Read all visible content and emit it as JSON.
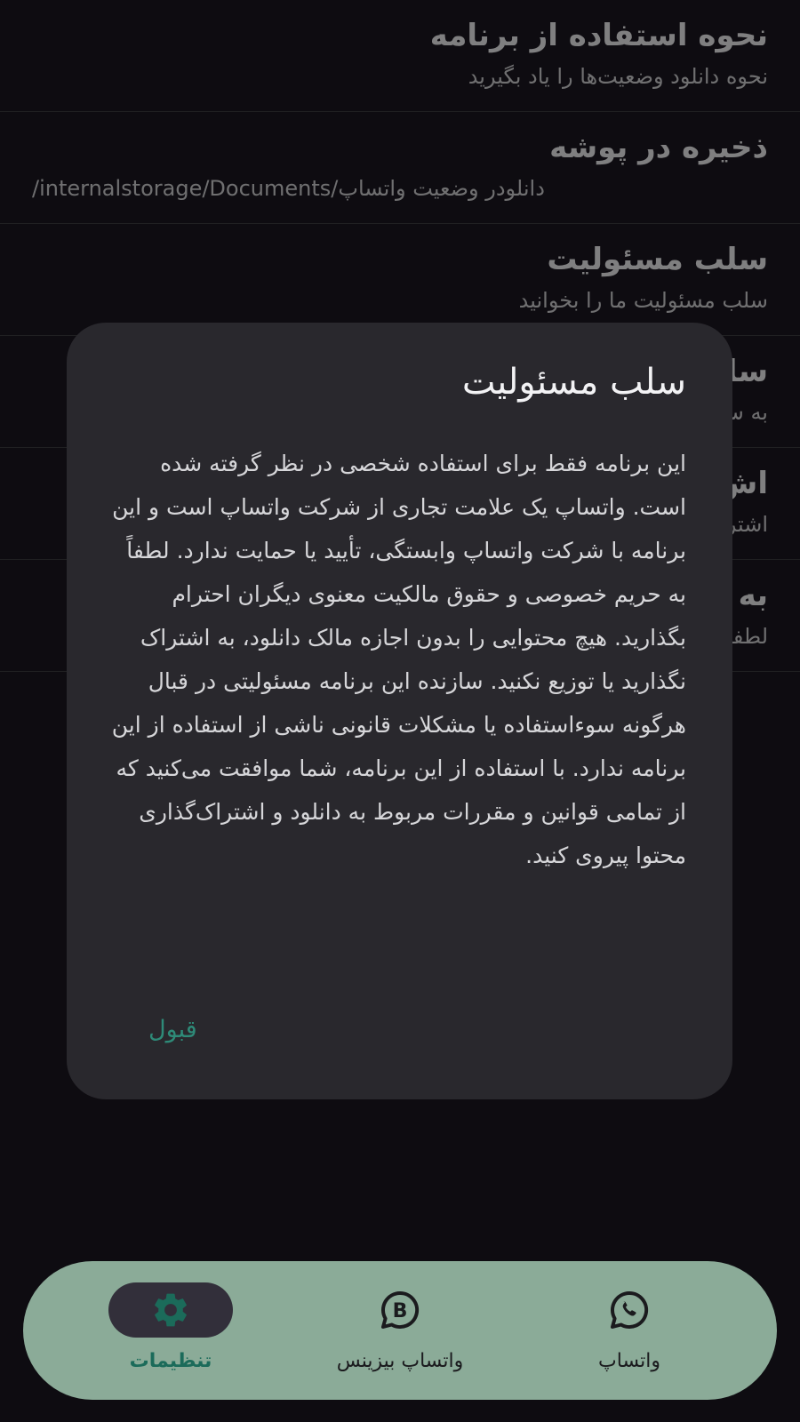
{
  "settings": {
    "items": [
      {
        "title": "نحوه استفاده از برنامه",
        "subtitle": "نحوه دانلود وضعیت‌ها را یاد بگیرید"
      },
      {
        "title": "ذخیره در پوشه",
        "subtitle": "/internalstorage/Documents/دانلودر وضعیت واتساپ"
      },
      {
        "title": "سلب مسئولیت",
        "subtitle": "سلب مسئولیت ما را بخوانید"
      },
      {
        "title": "سا",
        "subtitle": "به س"
      },
      {
        "title": "اش",
        "subtitle": "اشتر"
      },
      {
        "title": "به",
        "subtitle": "لطفا"
      }
    ]
  },
  "dialog": {
    "title": "سلب مسئولیت",
    "body": "این برنامه فقط برای استفاده شخصی در نظر گرفته شده است. واتساپ یک علامت تجاری از شرکت واتساپ است و این برنامه با شرکت واتساپ وابستگی، تأیید یا حمایت ندارد. لطفاً به حریم خصوصی و حقوق مالکیت معنوی دیگران احترام بگذارید. هیچ محتوایی را بدون اجازه مالک دانلود، به اشتراک نگذارید یا توزیع نکنید. سازنده این برنامه مسئولیتی در قبال هرگونه سوءاستفاده یا مشکلات قانونی ناشی از استفاده از این برنامه ندارد. با استفاده از این برنامه، شما موافقت می‌کنید که از تمامی قوانین و مقررات مربوط به دانلود و اشتراک‌گذاری محتوا پیروی کنید.",
    "accept_label": "قبول"
  },
  "bottom_nav": {
    "items": [
      {
        "label": "تنظیمات",
        "icon": "gear-icon",
        "active": true
      },
      {
        "label": "واتساپ بیزینس",
        "icon": "whatsapp-business-icon",
        "active": false
      },
      {
        "label": "واتساپ",
        "icon": "whatsapp-icon",
        "active": false
      }
    ]
  },
  "colors": {
    "background": "#0e0c11",
    "dialog": "#29282d",
    "accent": "#2e8a78",
    "nav_background": "#8bab98",
    "nav_active_pill": "#322f3a"
  }
}
